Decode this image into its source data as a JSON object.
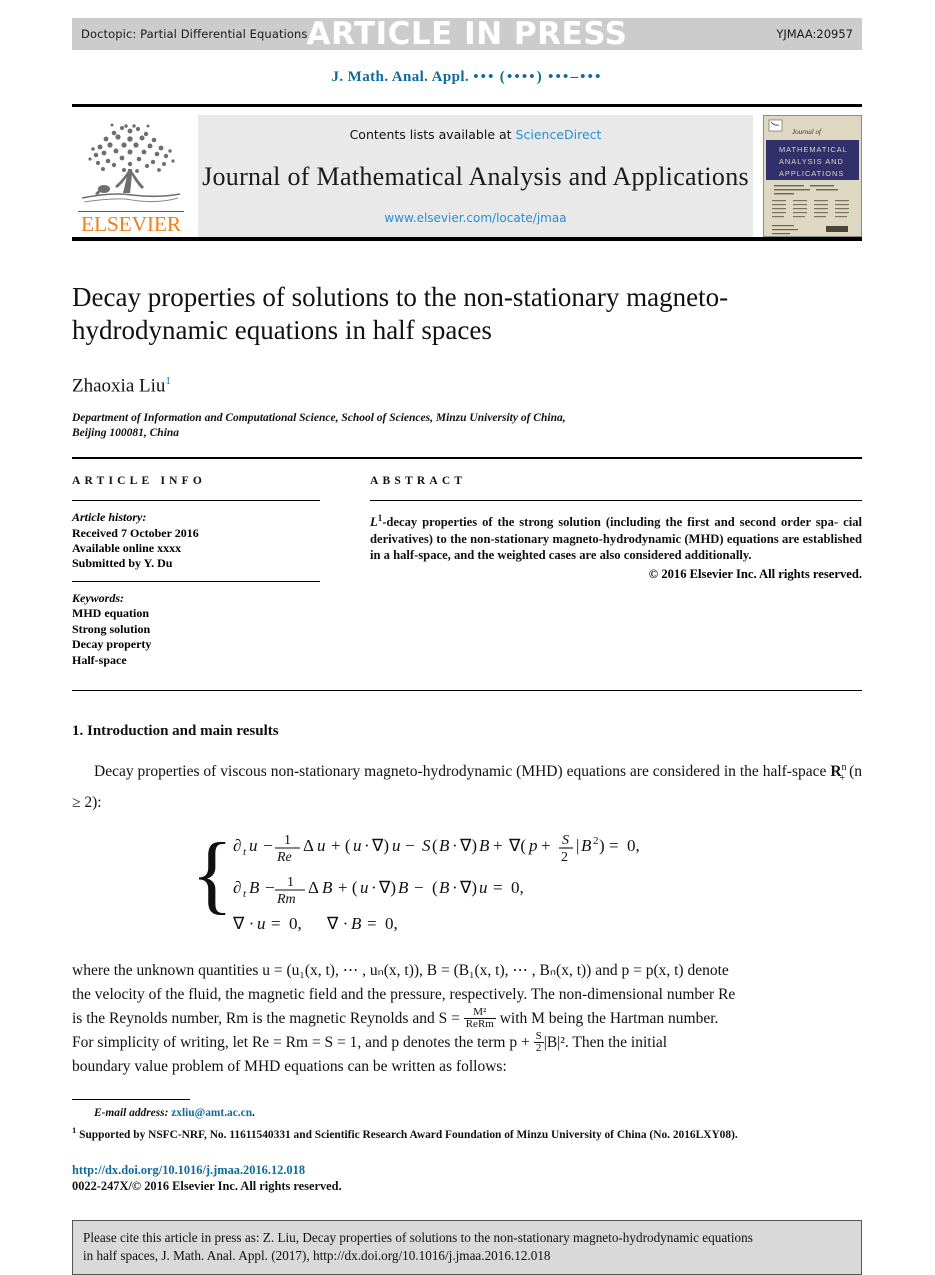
{
  "running_head": {
    "doctopic": "Doctopic: Partial Differential Equations",
    "article_in_press": "ARTICLE IN PRESS",
    "manuscript_code": "YJMAA:20957"
  },
  "cite_line": {
    "journal_abbrev": "J. Math. Anal. Appl.",
    "volume_dots": "•••",
    "year_dots": "(••••)",
    "pages_dots": "•••–•••"
  },
  "masthead": {
    "publisher": "ELSEVIER",
    "contents_prefix": "Contents lists available at",
    "contents_link": "ScienceDirect",
    "journal_name": "Journal of Mathematical Analysis and Applications",
    "journal_url": "www.elsevier.com/locate/jmaa",
    "cover_journal_of": "Journal of",
    "cover_title_line1": "MATHEMATICAL",
    "cover_title_line2": "ANALYSIS AND",
    "cover_title_line3": "APPLICATIONS",
    "cover_band_color": "#32306a",
    "cover_bg_color": "#ded7c2"
  },
  "article": {
    "title": "Decay properties of solutions to the non-stationary magneto-hydrodynamic equations in half spaces",
    "author": "Zhaoxia Liu",
    "author_footnote_marker": "1",
    "affiliation_line1": "Department of Information and Computational Science, School of Sciences, Minzu University of China,",
    "affiliation_line2": "Beijing 100081, China"
  },
  "article_info": {
    "heading": "ARTICLE INFO",
    "history_label": "Article history:",
    "received": "Received 7 October 2016",
    "available_online": "Available online xxxx",
    "submitted_by": "Submitted by Y. Du",
    "keywords_label": "Keywords:",
    "keywords": [
      "MHD equation",
      "Strong solution",
      "Decay property",
      "Half-space"
    ]
  },
  "abstract": {
    "heading": "ABSTRACT",
    "body_line1": "-decay properties of the strong solution (including the first and second order spa-",
    "body_line2": "cial derivatives) to the non-stationary magneto-hydrodynamic (MHD) equations are",
    "body_line3": "established in a half-space, and the weighted cases are also considered additionally.",
    "lead_symbol": "L",
    "lead_sup": "1",
    "copyright": "© 2016 Elsevier Inc. All rights reserved."
  },
  "body": {
    "section_title": "1. Introduction and main results",
    "para1_a": "Decay properties of viscous non-stationary magneto-hydrodynamic (MHD) equations are considered in the half-space ",
    "para1_b": " (n ≥ 2):",
    "halfspace_symbol": "R",
    "para2_line1": "where the unknown quantities u = (u₁(x, t), ⋯ , uₙ(x, t)), B = (B₁(x, t), ⋯ , Bₙ(x, t)) and p = p(x, t) denote",
    "para2_line2": "the velocity of the fluid, the magnetic field and the pressure, respectively. The non-dimensional number Re",
    "para2_line3_a": "is the Reynolds number, Rm is the magnetic Reynolds and S = ",
    "para2_line3_frac_num": "M²",
    "para2_line3_frac_den": "ReRm",
    "para2_line3_b": " with M being the Hartman number.",
    "para2_line4_a": "For simplicity of writing, let Re = Rm = S = 1, and p denotes the term p + ",
    "para2_line4_frac_num": "S",
    "para2_line4_frac_den": "2",
    "para2_line4_b": "|B|². Then the initial",
    "para2_line5": "boundary value problem of MHD equations can be written as follows:",
    "equations": {
      "eq1": "∂ₜu − (1/Re)Δu + (u · ∇)u − S(B · ∇)B + ∇(p + (S/2)|B|²) = 0,",
      "eq2": "∂ₜB − (1/Rm)ΔB + (u · ∇)B − (B · ∇)u = 0,",
      "eq3": "∇ · u = 0,    ∇ · B = 0,"
    }
  },
  "footnotes": {
    "email_label": "E-mail address:",
    "email": "zxliu@amt.ac.cn",
    "email_period": ".",
    "note_marker": "1",
    "note_line1": "Supported by NSFC-NRF, No. 11611540331 and Scientific Research Award Foundation of Minzu University of China (No.",
    "note_line2": "2016LXY08)."
  },
  "footer": {
    "doi": "http://dx.doi.org/10.1016/j.jmaa.2016.12.018",
    "issn": "0022-247X/© 2016 Elsevier Inc. All rights reserved."
  },
  "cite_box": {
    "line1": "Please cite this article in press as: Z. Liu, Decay properties of solutions to the non-stationary magneto-hydrodynamic equations",
    "line2": "in half spaces, J. Math. Anal. Appl. (2017), http://dx.doi.org/10.1016/j.jmaa.2016.12.018"
  },
  "colors": {
    "link_blue": "#0f6a9e",
    "sciencedirect_blue": "#2b8fd0",
    "elsevier_orange": "#f07f1a",
    "bar_gray": "#cccccc",
    "mast_gray": "#e9e9e9",
    "cite_box_gray": "#d9d9d9"
  }
}
